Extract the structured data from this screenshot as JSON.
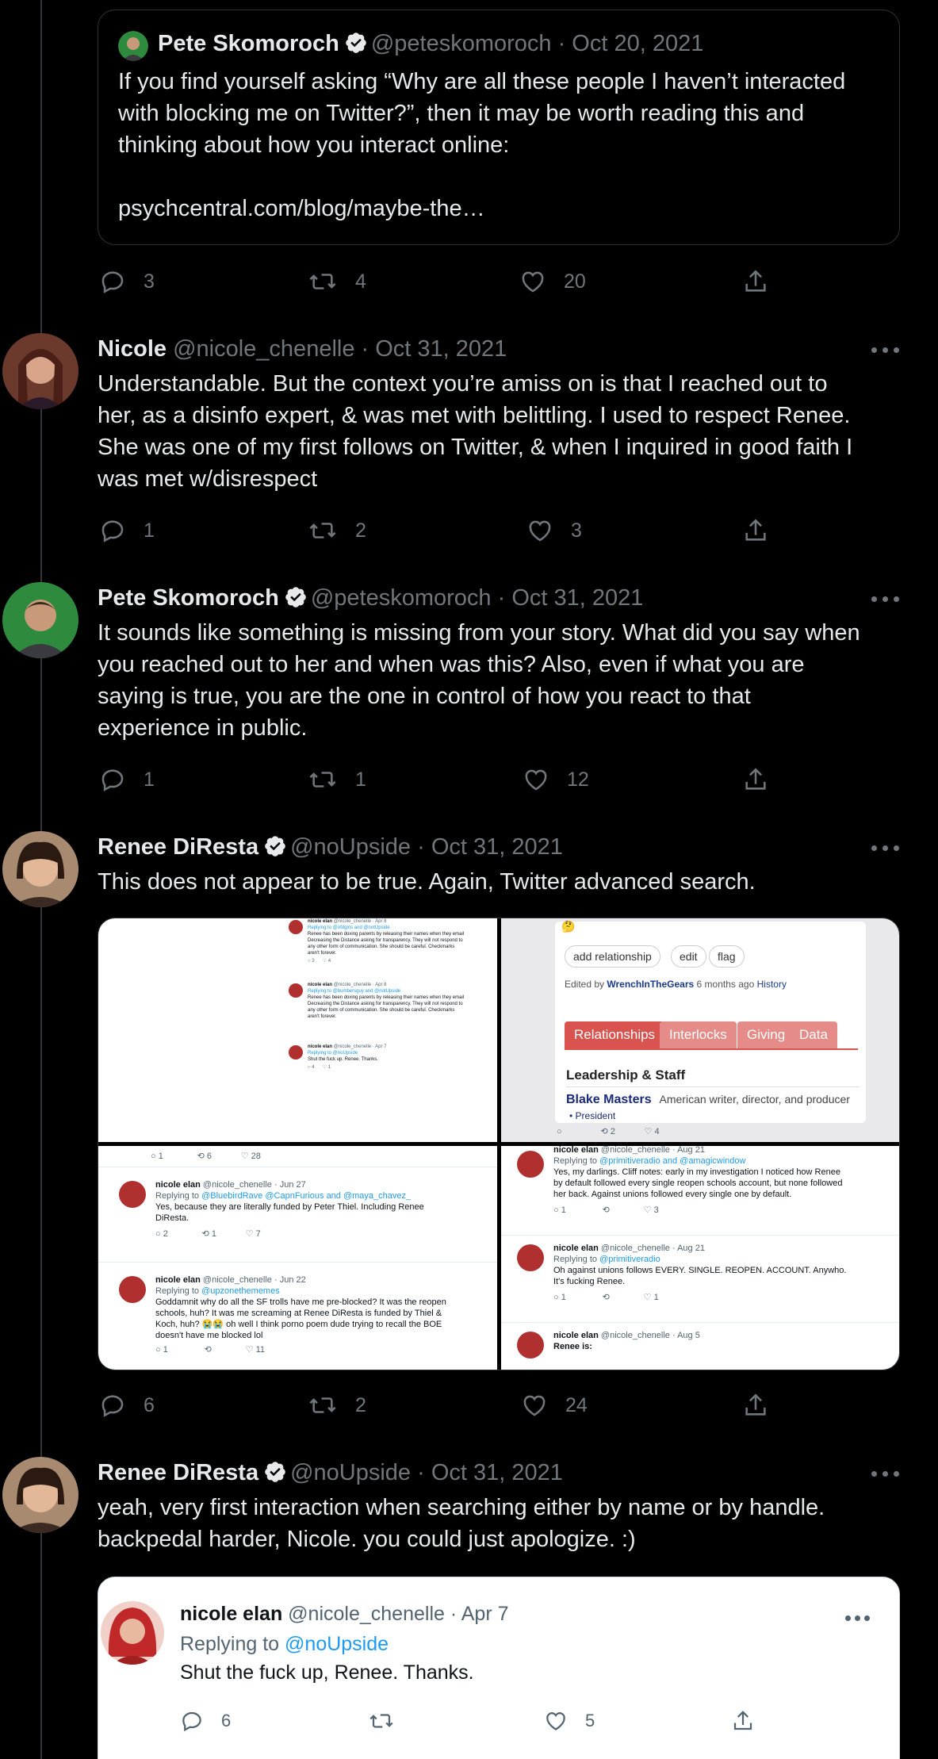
{
  "quoted_tweet": {
    "name": "Pete Skomoroch",
    "handle": "@peteskomoroch",
    "date": "· Oct 20, 2021",
    "text_lines": [
      "If you find yourself asking “Why are all these people I haven’t interacted",
      "with blocking me on Twitter?”, then it may be worth reading this and",
      "thinking about how you interact online:"
    ],
    "link": "psychcentral.com/blog/maybe-the…",
    "reply_count": "3",
    "retweet_count": "4",
    "like_count": "20"
  },
  "tweets": [
    {
      "name": "Nicole",
      "handle": "@nicole_chenelle",
      "date": "· Oct 31, 2021",
      "text_lines": [
        "Understandable. But the context you’re amiss on is that I reached out to",
        "her, as a disinfo expert, & was met with belittling. I used to respect Renee.",
        "She was one of my first follows on Twitter, & when I inquired in good faith I",
        "was met w/disrespect"
      ],
      "reply_count": "1",
      "retweet_count": "2",
      "like_count": "3"
    },
    {
      "name": "Pete Skomoroch",
      "handle": "@peteskomoroch",
      "date": "· Oct 31, 2021",
      "text_lines": [
        "It sounds like something is missing from your story. What did you say when",
        "you reached out to her and when was this? Also, even if what you are",
        "saying is true, you are the one in control of how you react to that",
        "experience in public."
      ],
      "reply_count": "1",
      "retweet_count": "1",
      "like_count": "12"
    },
    {
      "name": "Renee DiResta",
      "handle": "@noUpside",
      "date": "· Oct 31, 2021",
      "text_lines": [
        "This does not appear to be true. Again, Twitter advanced search."
      ],
      "reply_count": "6",
      "retweet_count": "2",
      "like_count": "24"
    },
    {
      "name": "Renee DiResta",
      "handle": "@noUpside",
      "date": "· Oct 31, 2021",
      "text_lines": [
        "yeah, very first interaction when searching either by name or by handle.",
        "backpedal harder, Nicole. you could just apologize. :)"
      ]
    }
  ],
  "media": {
    "tl": {
      "rows": [
        {
          "name": "nicole elan",
          "meta": "@nicole_chenelle · Apr 8",
          "reply": "Replying to @ofdgiris and @notUpside",
          "body": [
            "Renee has been doxing parents by releasing their names when they email",
            "Decreasing the Distance asking for transparency. They will not respond to",
            "any other form of communication. She should be careful. Checkmarks",
            "aren't forever."
          ],
          "counts": [
            "3",
            "4"
          ]
        },
        {
          "name": "nicole elan",
          "meta": "@nicole_chenelle · Apr 8",
          "reply": "Replying to @bumbersguy and @notUpside",
          "body": [
            "Renee has been doxing parents by releasing their names when they email",
            "Decreasing the Distance asking for transparency. They will not respond to",
            "any other form of communication. She should be careful. Checkmarks",
            "aren't forever."
          ],
          "counts": [
            "",
            ""
          ]
        },
        {
          "name": "nicole elan",
          "meta": "@nicole_chenelle · Apr 7",
          "reply": "Replying to @noUpside",
          "body": [
            "Shut the fuck up. Renee. Thanks."
          ],
          "counts": [
            "4",
            "1"
          ]
        }
      ]
    },
    "tr": {
      "emoji": "🤔",
      "pills": [
        "add relationship",
        "edit",
        "flag"
      ],
      "edited_prefix": "Edited by",
      "edited_user": "WrenchInTheGears",
      "edited_suffix": "6 months ago",
      "history": "History",
      "tabs": [
        "Relationships",
        "Interlocks",
        "Giving",
        "Data"
      ],
      "section": "Leadership & Staff",
      "person": "Blake Masters",
      "person_desc": "American writer, director, and producer",
      "role": "• President",
      "counts": [
        "2",
        "4"
      ]
    },
    "bl": {
      "top_counts": [
        "1",
        "6",
        "28"
      ],
      "rows": [
        {
          "name": "nicole elan",
          "meta": "@nicole_chenelle · Jun 27",
          "reply_prefix": "Replying to",
          "reply": "@BluebirdRave @CapnFurious and @maya_chavez_",
          "body": [
            "Yes, because they are literally funded by Peter Thiel. Including Renee",
            "DiResta."
          ],
          "counts": [
            "2",
            "1",
            "7"
          ]
        },
        {
          "name": "nicole elan",
          "meta": "@nicole_chenelle · Jun 22",
          "reply_prefix": "Replying to",
          "reply": "@upzonethememes",
          "body": [
            "Goddamnit why do all the SF trolls have me pre-blocked? It was the reopen",
            "schools, huh? It was me screaming at Renee DiResta is funded by Thiel &",
            "Koch, huh? 😭😭 oh well I think porno poem dude trying to recall the BOE",
            "doesn't have me blocked lol"
          ],
          "counts": [
            "1",
            "",
            "11"
          ]
        }
      ]
    },
    "br": {
      "rows": [
        {
          "name": "nicole elan",
          "meta": "@nicole_chenelle · Aug 21",
          "reply_prefix": "Replying to",
          "reply": "@primitiveradio and @amagicwindow",
          "body": [
            "Yes, my darlings. Cliff notes: early in my investigation I noticed how Renee",
            "by default followed every single reopen schools account, but none followed",
            "her back. Against unions followed every single one by default."
          ],
          "counts": [
            "1",
            "",
            "3"
          ]
        },
        {
          "name": "nicole elan",
          "meta": "@nicole_chenelle · Aug 21",
          "reply_prefix": "Replying to",
          "reply": "@primitiveradio",
          "body": [
            "Oh against unions follows EVERY. SINGLE. REOPEN. ACCOUNT. Anywho.",
            "It's fucking Renee."
          ],
          "counts": [
            "1",
            "",
            "1"
          ]
        },
        {
          "name": "nicole elan",
          "meta": "@nicole_chenelle · Aug 5",
          "reply_prefix": "",
          "reply": "",
          "body": [
            "Renee is:"
          ],
          "counts": []
        }
      ]
    }
  },
  "embedded_quote": {
    "name": "nicole elan",
    "handle": "@nicole_chenelle",
    "date": "· Apr 7",
    "replying_prefix": "Replying to",
    "replying_handle": "@noUpside",
    "text": "Shut the fuck up, Renee. Thanks.",
    "reply_count": "6",
    "like_count": "5"
  },
  "icons": [
    "reply-icon",
    "retweet-icon",
    "like-icon",
    "share-icon",
    "verified-icon",
    "more-icon"
  ],
  "colors": {
    "background": "#000000",
    "text": "#e7e9ea",
    "muted": "#71767b",
    "link": "#1d9bf0",
    "border": "#2f3336",
    "verified": "#e7e9ea"
  }
}
